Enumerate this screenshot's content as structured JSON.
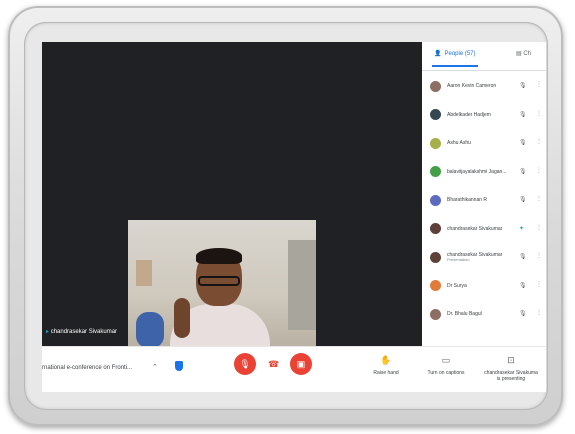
{
  "participant_name": "chandrasekar Sivakumar",
  "panel": {
    "people_tab": "People (57)",
    "chat_tab": "Ch",
    "participants": [
      {
        "name": "Aaron Kevin Cameron",
        "sub": "",
        "avatar_color": "#8d6e63",
        "mic": "muted"
      },
      {
        "name": "Abdelkader Hadjem",
        "sub": "",
        "avatar_color": "#37474f",
        "mic": "muted"
      },
      {
        "name": "Ashu Ashu",
        "sub": "",
        "avatar_color": "#a5b04a",
        "mic": "muted"
      },
      {
        "name": "balaviijayalakshmi Jagan...",
        "sub": "",
        "avatar_color": "#43a047",
        "mic": "muted"
      },
      {
        "name": "Bharathikannan R",
        "sub": "",
        "avatar_color": "#5c6bc0",
        "mic": "muted"
      },
      {
        "name": "chandrasekar Sivakumar",
        "sub": "",
        "avatar_color": "#5d4037",
        "mic": "active"
      },
      {
        "name": "chandrasekar Sivakumar",
        "sub": "Presentation",
        "avatar_color": "#5d4037",
        "mic": "muted"
      },
      {
        "name": "Dr Surya",
        "sub": "",
        "avatar_color": "#e07b39",
        "mic": "muted"
      },
      {
        "name": "Dr. Bhalu Bagul",
        "sub": "",
        "avatar_color": "#8d6e63",
        "mic": "muted"
      }
    ]
  },
  "toolbar": {
    "meeting_title": "rnational e-conference on Fronti...",
    "raise_hand": "Raise hand",
    "captions": "Turn on captions",
    "presenting": "chandrasekar Sivakuma",
    "presenting_sub": "is presenting"
  },
  "colors": {
    "accent": "#1a73e8",
    "danger": "#ea4335"
  }
}
